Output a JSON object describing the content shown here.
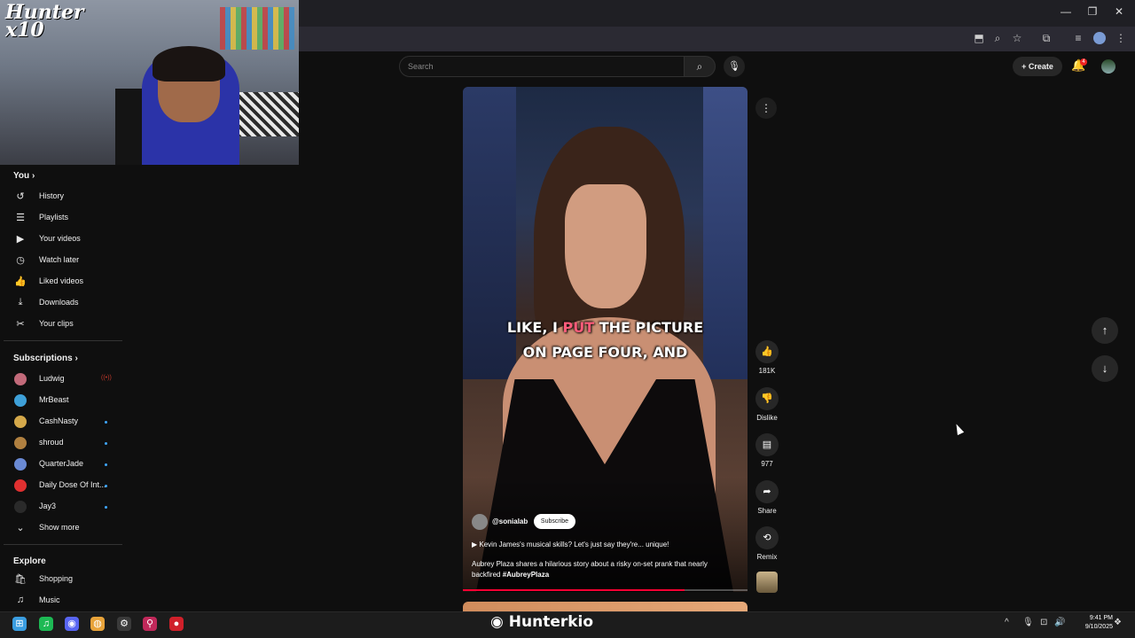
{
  "browser": {
    "minimize_icon": "—",
    "restore_icon": "❐",
    "close_icon": "✕",
    "ext_icons": [
      "⬒",
      "⌕",
      "☆",
      "⧉",
      "≡"
    ],
    "menu_icon": "⋮"
  },
  "webcam": {
    "overlay_logo": "Hunter\nx10"
  },
  "sidebar": {
    "you_section": {
      "title": "You",
      "chevron": "›"
    },
    "you_items": [
      {
        "icon": "↺",
        "label": "History"
      },
      {
        "icon": "☰",
        "label": "Playlists"
      },
      {
        "icon": "▶",
        "label": "Your videos"
      },
      {
        "icon": "◷",
        "label": "Watch later"
      },
      {
        "icon": "👍",
        "label": "Liked videos"
      },
      {
        "icon": "⤓",
        "label": "Downloads"
      },
      {
        "icon": "✂",
        "label": "Your clips"
      }
    ],
    "subscriptions_section": {
      "title": "Subscriptions",
      "chevron": "›"
    },
    "subscriptions": [
      {
        "label": "Ludwig",
        "color": "#c26a7a",
        "indicator": "live"
      },
      {
        "label": "MrBeast",
        "color": "#3ea0d8",
        "indicator": "dot"
      },
      {
        "label": "CashNasty",
        "color": "#d4a84a",
        "indicator": "dot"
      },
      {
        "label": "shroud",
        "color": "#b08040",
        "indicator": "dot"
      },
      {
        "label": "QuarterJade",
        "color": "#6a8ad4",
        "indicator": "dot"
      },
      {
        "label": "Daily Dose Of Int...",
        "color": "#e03030",
        "indicator": "dot"
      },
      {
        "label": "Jay3",
        "color": "#2a2a2a",
        "indicator": "dot"
      }
    ],
    "show_more": {
      "icon": "⌄",
      "label": "Show more"
    },
    "explore_section": {
      "title": "Explore"
    },
    "explore_items": [
      {
        "icon": "🛍",
        "label": "Shopping"
      },
      {
        "icon": "♫",
        "label": "Music"
      }
    ]
  },
  "header": {
    "search_placeholder": "Search",
    "search_icon": "⌕",
    "mic_icon": "🎙",
    "create_label": "+ Create",
    "bell_icon": "🔔",
    "notification_count": "4"
  },
  "short": {
    "caption_line1_pre": "LIKE, I ",
    "caption_line1_hl": "PUT",
    "caption_line1_post": " THE PICTURE",
    "caption_line2": "ON PAGE FOUR, AND",
    "channel": "@sonialab",
    "subscribe_label": "Subscribe",
    "playlist_line": "▶  Kevin James's musical skills? Let's just say they're... unique!",
    "description": "Aubrey Plaza shares a hilarious story about a risky on-set prank that nearly backfired ",
    "hashtag": "#AubreyPlaza",
    "progress": 0.78
  },
  "actions": {
    "more_icon": "⋮",
    "like_icon": "👍",
    "like_count": "181K",
    "dislike_icon": "👎",
    "dislike_label": "Dislike",
    "comment_icon": "▤",
    "comment_count": "977",
    "share_icon": "➦",
    "share_label": "Share",
    "remix_icon": "⟲",
    "remix_label": "Remix"
  },
  "nav": {
    "up_icon": "↑",
    "down_icon": "↓"
  },
  "taskbar": {
    "icons": [
      {
        "name": "windows-start-icon",
        "glyph": "⊞",
        "color": "#3a9de0"
      },
      {
        "name": "spotify-icon",
        "glyph": "♫",
        "color": "#1db954"
      },
      {
        "name": "discord-icon",
        "glyph": "◉",
        "color": "#5865f2"
      },
      {
        "name": "chrome-icon",
        "glyph": "◍",
        "color": "#e8a33a"
      },
      {
        "name": "steam-icon",
        "glyph": "⚙",
        "color": "#3a3a3a"
      },
      {
        "name": "pin-app-icon",
        "glyph": "⚲",
        "color": "#c0285a"
      },
      {
        "name": "record-app-icon",
        "glyph": "●",
        "color": "#d0202a"
      }
    ],
    "watermark": "Hunterkio",
    "tray_icons": [
      "^",
      "🎙",
      "⊡",
      "🔊"
    ],
    "time": "9:41 PM",
    "date": "9/10/2025"
  }
}
